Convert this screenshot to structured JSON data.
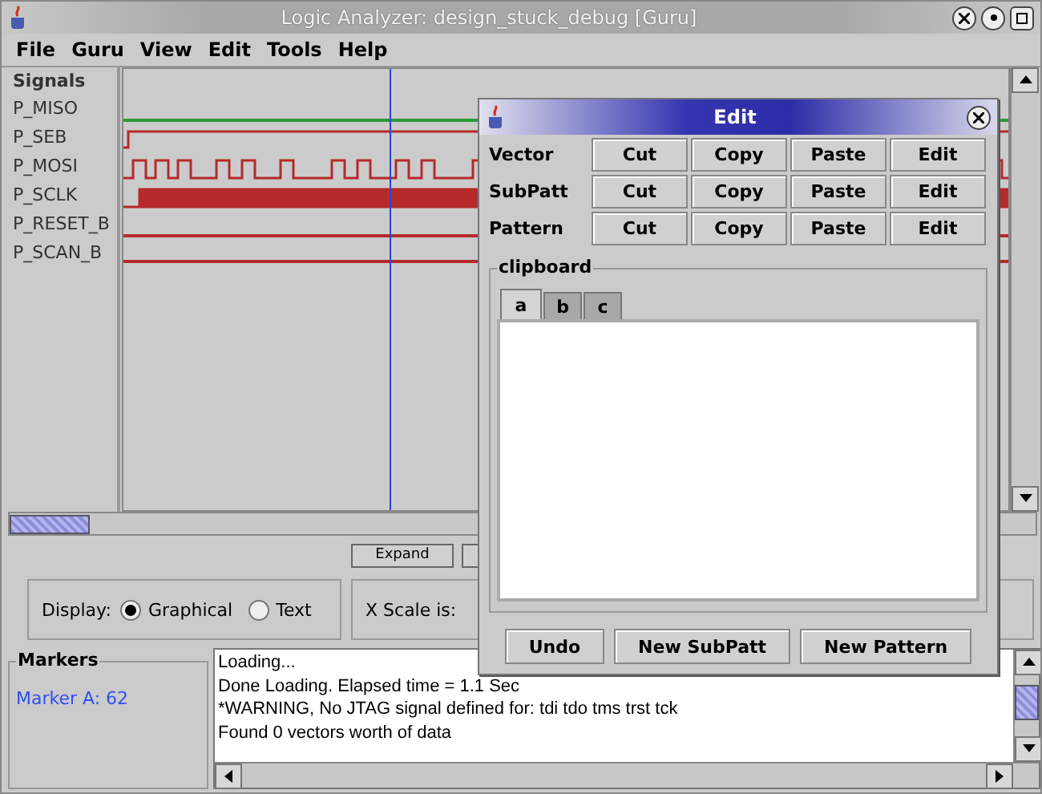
{
  "window": {
    "title": "Logic Analyzer: design_stuck_debug [Guru]"
  },
  "menu": [
    "File",
    "Guru",
    "View",
    "Edit",
    "Tools",
    "Help"
  ],
  "signals": {
    "heading": "Signals",
    "items": [
      {
        "name": "P_MISO",
        "color": "#2a9a3a",
        "kind": "flat"
      },
      {
        "name": "P_SEB",
        "color": "#b52a2a",
        "kind": "step"
      },
      {
        "name": "P_MOSI",
        "color": "#b52a2a",
        "kind": "pulses"
      },
      {
        "name": "P_SCLK",
        "color": "#b52a2a",
        "kind": "clock"
      },
      {
        "name": "P_RESET_B",
        "color": "#b52a2a",
        "kind": "flat"
      },
      {
        "name": "P_SCAN_B",
        "color": "#b52a2a",
        "kind": "low"
      }
    ]
  },
  "expand_button": "Expand",
  "display": {
    "label": "Display:",
    "options": [
      {
        "label": "Graphical",
        "selected": true
      },
      {
        "label": "Text",
        "selected": false
      }
    ]
  },
  "x_scale": {
    "label": "X Scale is:"
  },
  "markers": {
    "title": "Markers",
    "items": [
      "Marker A: 62"
    ]
  },
  "log": [
    "Loading...",
    "Done Loading. Elapsed time = 1.1 Sec",
    "*WARNING, No JTAG signal defined for:  tdi tdo tms trst tck",
    "Found 0 vectors worth of data"
  ],
  "edit_dialog": {
    "title": "Edit",
    "rows": [
      {
        "label": "Vector",
        "buttons": [
          "Cut",
          "Copy",
          "Paste",
          "Edit"
        ]
      },
      {
        "label": "SubPatt",
        "buttons": [
          "Cut",
          "Copy",
          "Paste",
          "Edit"
        ]
      },
      {
        "label": "Pattern",
        "buttons": [
          "Cut",
          "Copy",
          "Paste",
          "Edit"
        ]
      }
    ],
    "clipboard": {
      "title": "clipboard",
      "tabs": [
        {
          "label": "a",
          "selected": true
        },
        {
          "label": "b",
          "selected": false
        },
        {
          "label": "c",
          "selected": false
        }
      ]
    },
    "buttons": [
      "Undo",
      "New SubPatt",
      "New Pattern"
    ]
  }
}
